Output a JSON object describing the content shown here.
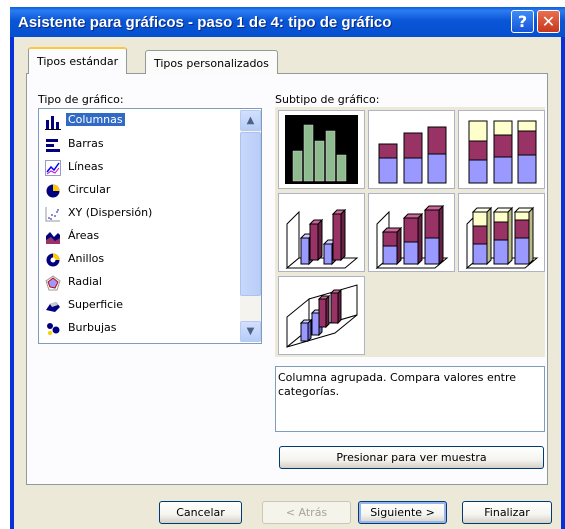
{
  "window": {
    "title": "Asistente para gráficos - paso 1 de 4: tipo de gráfico",
    "help_glyph": "?",
    "close_glyph": "✕",
    "title_color": "#0a56d8"
  },
  "tabs": [
    {
      "label": "Tipos estándar",
      "selected": true
    },
    {
      "label": "Tipos personalizados",
      "selected": false
    }
  ],
  "chart_type": {
    "label": "Tipo de gráfico:",
    "items": [
      {
        "label": "Columnas",
        "icon": "column-chart-icon",
        "selected": true
      },
      {
        "label": "Barras",
        "icon": "bar-chart-icon"
      },
      {
        "label": "Líneas",
        "icon": "line-chart-icon"
      },
      {
        "label": "Circular",
        "icon": "pie-chart-icon"
      },
      {
        "label": "XY (Dispersión)",
        "icon": "scatter-chart-icon"
      },
      {
        "label": "Áreas",
        "icon": "area-chart-icon"
      },
      {
        "label": "Anillos",
        "icon": "doughnut-chart-icon"
      },
      {
        "label": "Radial",
        "icon": "radar-chart-icon"
      },
      {
        "label": "Superficie",
        "icon": "surface-chart-icon"
      },
      {
        "label": "Burbujas",
        "icon": "bubble-chart-icon"
      }
    ]
  },
  "subtype": {
    "label": "Subtipo de gráfico:",
    "selected_index": 0,
    "count": 7,
    "colors": {
      "blue": "#9999ff",
      "maroon": "#993366",
      "cream": "#ffffcc",
      "selected_bg": "#000000",
      "selected_bar": "#8fbc8f"
    }
  },
  "description": "Columna agrupada. Compara valores entre categorías.",
  "buttons": {
    "preview": "Presionar para ver muestra",
    "cancel": "Cancelar",
    "back": "< Atrás",
    "next": "Siguiente >",
    "finish": "Finalizar"
  }
}
